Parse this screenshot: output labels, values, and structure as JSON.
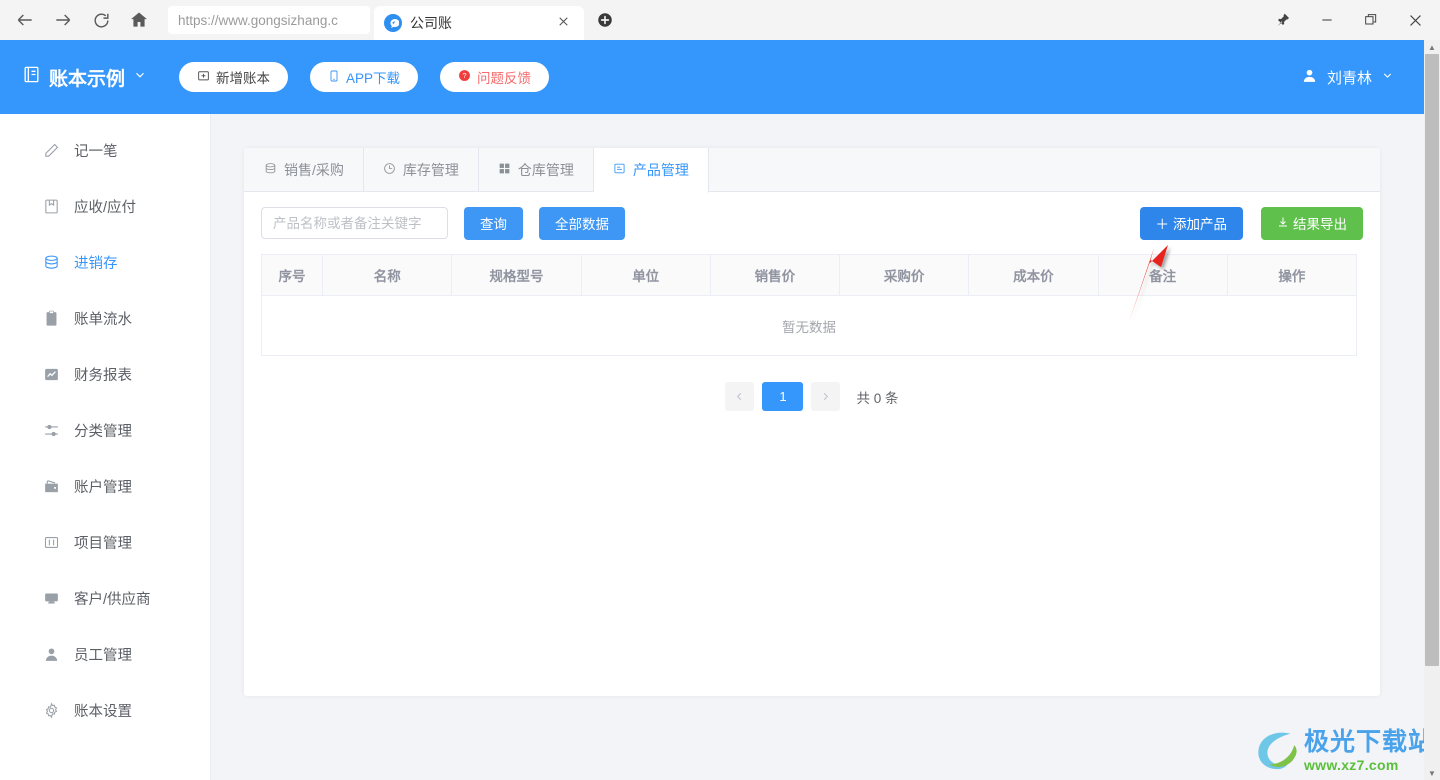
{
  "browser": {
    "url": "https://www.gongsizhang.c",
    "tab_title": "公司账",
    "back_icon": "back-arrow-icon",
    "forward_icon": "forward-arrow-icon",
    "reload_icon": "reload-icon",
    "home_icon": "home-icon",
    "new_tab_icon": "new-tab-icon",
    "close_tab_icon": "close-tab-icon",
    "pin_icon": "pin-icon",
    "minimize_icon": "minimize-icon",
    "maximize_icon": "maximize-icon",
    "close_icon": "close-window-icon"
  },
  "header": {
    "book_name": "账本示例",
    "book_icon": "book-icon",
    "book_caret": "chevron-down-icon",
    "pills": [
      {
        "label": "新增账本",
        "icon": "add-book-icon"
      },
      {
        "label": "APP下载",
        "icon": "mobile-icon"
      },
      {
        "label": "问题反馈",
        "icon": "help-circle-icon"
      }
    ],
    "user_name": "刘青林",
    "user_icon": "user-avatar-icon",
    "user_caret": "chevron-down-icon",
    "brand_color": "#3596fb"
  },
  "sidebar": {
    "items": [
      {
        "label": "记一笔",
        "icon": "pencil-icon",
        "active": false
      },
      {
        "label": "应收/应付",
        "icon": "book-ledger-icon",
        "active": false
      },
      {
        "label": "进销存",
        "icon": "database-icon",
        "active": true
      },
      {
        "label": "账单流水",
        "icon": "clipboard-icon",
        "active": false
      },
      {
        "label": "财务报表",
        "icon": "chart-line-icon",
        "active": false
      },
      {
        "label": "分类管理",
        "icon": "sliders-icon",
        "active": false
      },
      {
        "label": "账户管理",
        "icon": "wallet-icon",
        "active": false
      },
      {
        "label": "项目管理",
        "icon": "layout-icon",
        "active": false
      },
      {
        "label": "客户/供应商",
        "icon": "monitor-icon",
        "active": false
      },
      {
        "label": "员工管理",
        "icon": "person-icon",
        "active": false
      },
      {
        "label": "账本设置",
        "icon": "gear-icon",
        "active": false
      }
    ]
  },
  "content": {
    "tabs": [
      {
        "label": "销售/采购",
        "icon": "database-icon",
        "selected": false
      },
      {
        "label": "库存管理",
        "icon": "clock-icon",
        "selected": false
      },
      {
        "label": "仓库管理",
        "icon": "grid-icon",
        "selected": false
      },
      {
        "label": "产品管理",
        "icon": "product-icon",
        "selected": true
      }
    ],
    "toolbar": {
      "search_placeholder": "产品名称或者备注关键字",
      "search_value": "",
      "query_label": "查询",
      "all_data_label": "全部数据",
      "add_product_label": "添加产品",
      "add_product_icon": "plus-icon",
      "export_label": "结果导出",
      "export_icon": "download-icon",
      "add_button_color": "#2f86ea",
      "export_button_color": "#5fc04c"
    },
    "table": {
      "columns": [
        "序号",
        "名称",
        "规格型号",
        "单位",
        "销售价",
        "采购价",
        "成本价",
        "备注",
        "操作"
      ],
      "rows": [],
      "empty_text": "暂无数据"
    },
    "pagination": {
      "prev_icon": "chevron-left-icon",
      "next_icon": "chevron-right-icon",
      "current_page": "1",
      "total_text": "共 0 条"
    }
  },
  "annotation": {
    "arrow_color": "#e8231f",
    "arrow_name": "red-pointer-arrow"
  },
  "watermark": {
    "title": "极光下载站",
    "site": "www.xz7.com",
    "logo_icon": "aurora-logo-icon"
  }
}
